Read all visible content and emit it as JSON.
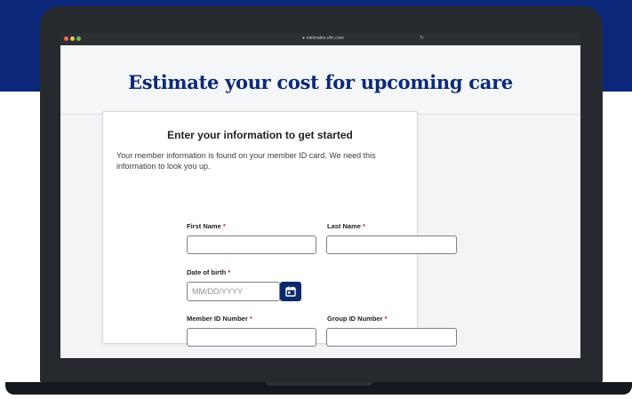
{
  "browser": {
    "url": "estimates.uhc.com"
  },
  "hero": {
    "title": "Estimate your cost for upcoming care"
  },
  "form": {
    "heading": "Enter your information to get started",
    "description": "Your member information is found on your member ID card. We need this information to look you up.",
    "required_marker": "*",
    "fields": {
      "first_name": {
        "label": "First Name",
        "value": ""
      },
      "last_name": {
        "label": "Last Name",
        "value": ""
      },
      "dob": {
        "label": "Date of birth",
        "placeholder": "MM/DD/YYYY"
      },
      "member_id": {
        "label": "Member ID Number",
        "value": ""
      },
      "group_id": {
        "label": "Group ID Number",
        "value": ""
      }
    }
  },
  "icons": {
    "calendar": "calendar-icon",
    "lock": "lock-icon",
    "reload": "reload-icon"
  },
  "colors": {
    "brand_navy": "#0a2779",
    "required_red": "#d0192b",
    "calendar_button": "#0b2a6c"
  }
}
